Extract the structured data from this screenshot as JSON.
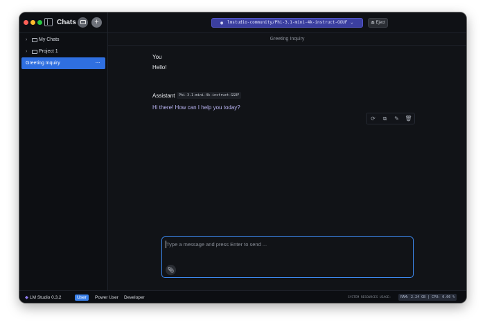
{
  "window": {
    "sidebar_title": "Chats",
    "new_folder_icon": "folder-plus-icon",
    "new_chat_icon": "plus-icon"
  },
  "sidebar": {
    "items": [
      {
        "label": "My Chats",
        "type": "folder",
        "expanded": false
      },
      {
        "label": "Project 1",
        "type": "folder",
        "expanded": false
      },
      {
        "label": "Greeting Inquiry",
        "type": "chat",
        "active": true,
        "menu_icon": "···"
      }
    ]
  },
  "toolbar": {
    "model_name": "lmstudio-community/Phi-3.1-mini-4k-instruct-GGUF",
    "eject_label": "Eject"
  },
  "chat": {
    "title": "Greeting Inquiry",
    "messages": [
      {
        "role": "You",
        "text": "Hello!"
      },
      {
        "role": "Assistant",
        "model_tag": "Phi-3.1-mini-4k-instruct-GGUF",
        "text": "Hi there! How can I help you today?"
      }
    ]
  },
  "composer": {
    "placeholder": "Type a message and press Enter to send ..."
  },
  "statusbar": {
    "app_name": "LM Studio 0.3.2",
    "modes": [
      "User",
      "Power User",
      "Developer"
    ],
    "active_mode": "User",
    "system_label": "SYSTEM RESOURCES USAGE:",
    "resources": "RAM: 2.24 GB  |  CPU: 0.00 %"
  },
  "colors": {
    "accent": "#2f6fe0",
    "model_select": "#3b3fa0",
    "assistant_text": "#b9b4f2",
    "composer_border": "#3d8bf2"
  }
}
